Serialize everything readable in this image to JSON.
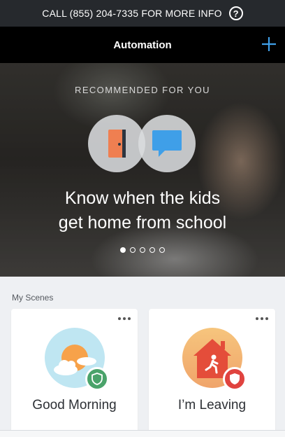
{
  "topbar": {
    "text": "CALL (855) 204-7335 FOR MORE INFO",
    "help_icon": "?"
  },
  "navbar": {
    "title": "Automation",
    "add_icon": "plus-icon",
    "accent": "#3f9fe8"
  },
  "hero": {
    "kicker": "RECOMMENDED FOR YOU",
    "headline_line1": "Know when the kids",
    "headline_line2": "get home from school",
    "icons": [
      "door-icon",
      "chat-bubble-icon"
    ],
    "pager": {
      "count": 5,
      "active": 1
    }
  },
  "scenes": {
    "title": "My Scenes",
    "items": [
      {
        "label": "Good Morning",
        "icon": "sun-clouds-icon",
        "badge": "shield-icon",
        "badge_color": "#4aa36a"
      },
      {
        "label": "I’m Leaving",
        "icon": "house-walking-person-icon",
        "badge": "shield-icon",
        "badge_color": "#e0433f"
      }
    ]
  }
}
